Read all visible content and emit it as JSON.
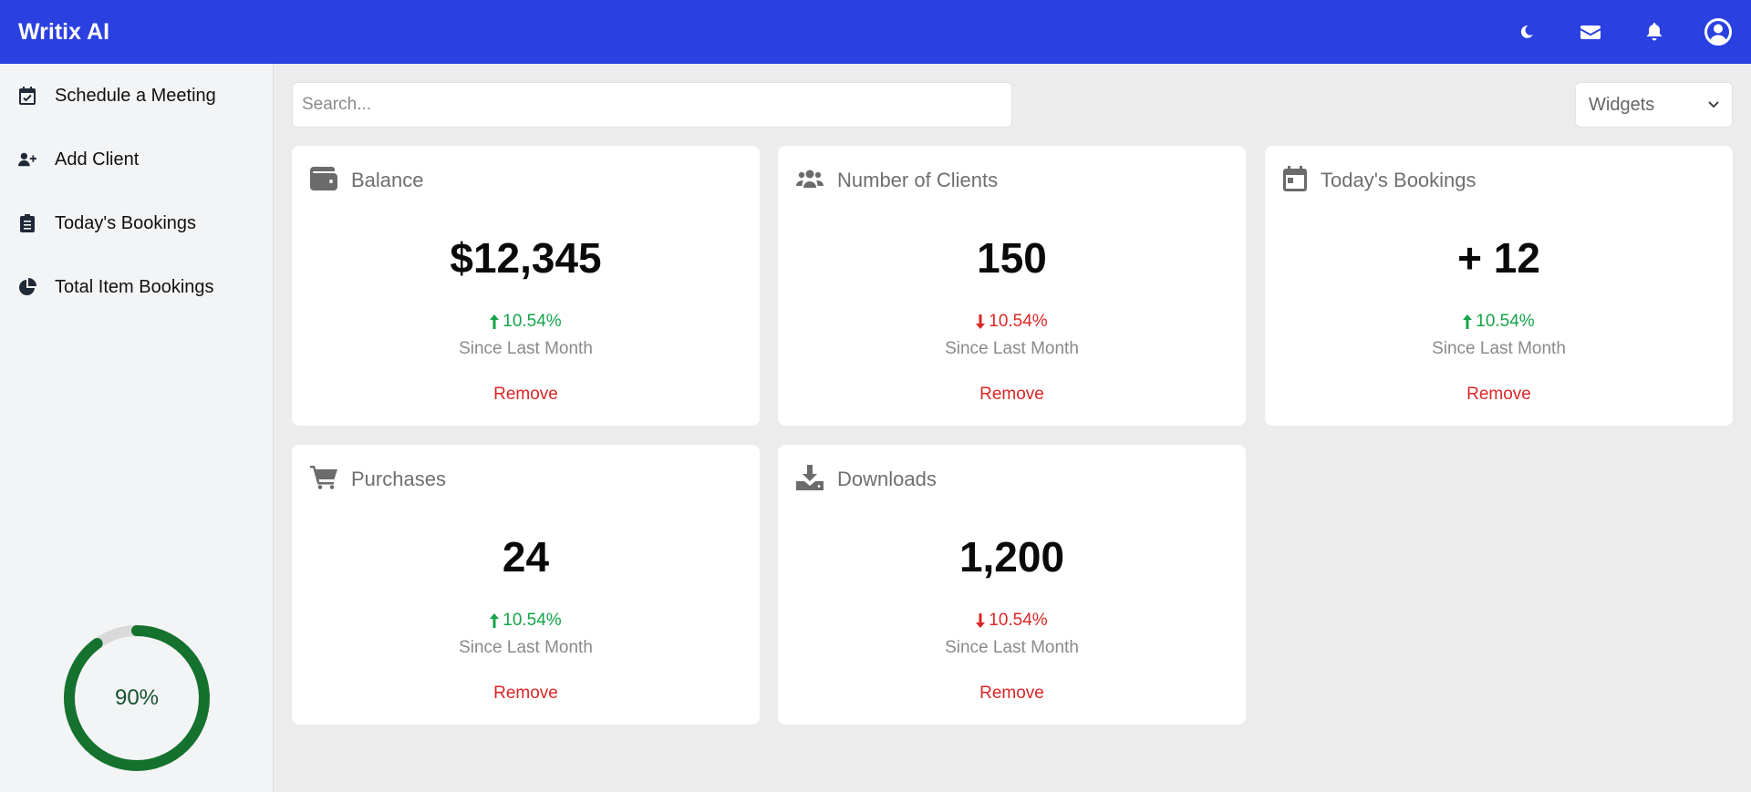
{
  "app": {
    "title": "Writix AI"
  },
  "topbar": {
    "icons": [
      "moon-icon",
      "envelope-icon",
      "bell-icon",
      "user-circle-icon"
    ]
  },
  "sidebar": {
    "items": [
      {
        "label": "Schedule a Meeting",
        "icon": "calendar-check-icon"
      },
      {
        "label": "Add Client",
        "icon": "user-plus-icon"
      },
      {
        "label": "Today's Bookings",
        "icon": "clipboard-list-icon"
      },
      {
        "label": "Total Item Bookings",
        "icon": "chart-pie-icon"
      }
    ],
    "progress": {
      "value": 0.9,
      "label": "90%"
    }
  },
  "search": {
    "placeholder": "Search...",
    "value": ""
  },
  "widgets_select": {
    "selected": "Widgets"
  },
  "colors": {
    "accent": "#2a40e0",
    "up": "#16a34a",
    "down": "#dc2626",
    "ring": "#15722e",
    "ring_track": "#d9d9d9"
  },
  "cards": [
    {
      "title": "Balance",
      "icon": "wallet-icon",
      "value": "$12,345",
      "change": "10.54%",
      "direction": "up",
      "since": "Since Last Month",
      "remove": "Remove"
    },
    {
      "title": "Number of Clients",
      "icon": "users-icon",
      "value": "150",
      "change": "10.54%",
      "direction": "down",
      "since": "Since Last Month",
      "remove": "Remove"
    },
    {
      "title": "Today's Bookings",
      "icon": "calendar-icon",
      "value": "+ 12",
      "change": "10.54%",
      "direction": "up",
      "since": "Since Last Month",
      "remove": "Remove"
    },
    {
      "title": "Purchases",
      "icon": "cart-icon",
      "value": "24",
      "change": "10.54%",
      "direction": "up",
      "since": "Since Last Month",
      "remove": "Remove"
    },
    {
      "title": "Downloads",
      "icon": "download-icon",
      "value": "1,200",
      "change": "10.54%",
      "direction": "down",
      "since": "Since Last Month",
      "remove": "Remove"
    }
  ]
}
